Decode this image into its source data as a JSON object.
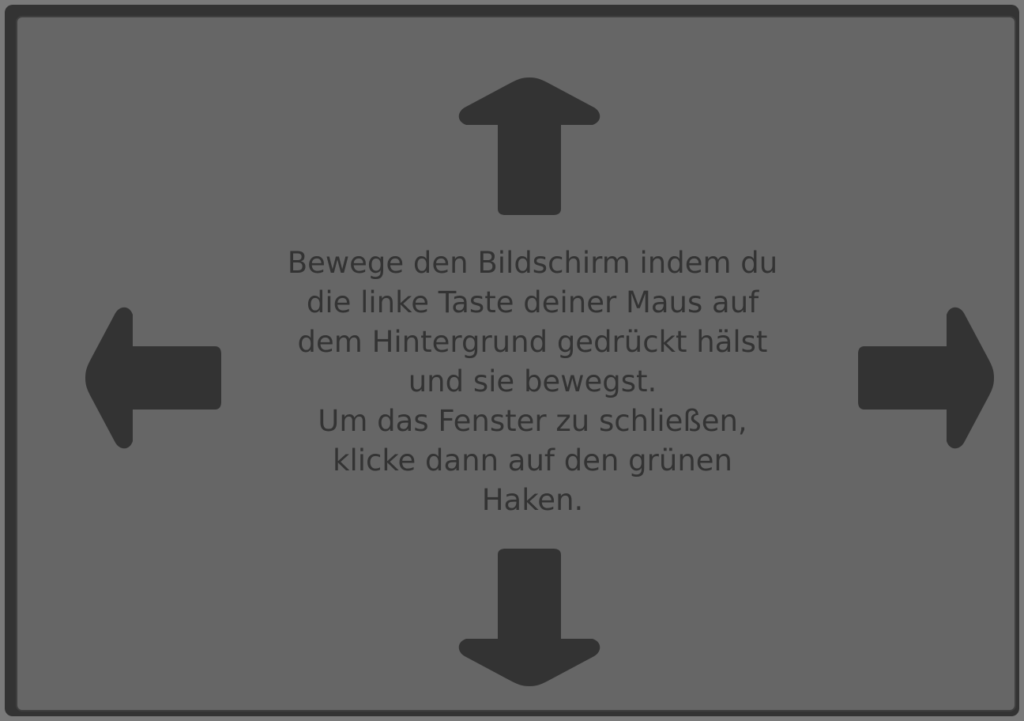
{
  "colors": {
    "outer_background": "#7a7a7a",
    "frame": "#333333",
    "panel": "#666666",
    "arrow": "#333333",
    "text": "#333333"
  },
  "arrows": {
    "up": "arrow-up-icon",
    "down": "arrow-down-icon",
    "left": "arrow-left-icon",
    "right": "arrow-right-icon"
  },
  "instructions": {
    "lines": [
      "Bewege den Bildschirm indem du",
      "die linke Taste deiner Maus auf",
      "dem Hintergrund gedrückt hälst",
      "und sie bewegst.",
      "Um das Fenster zu schließen,",
      "klicke dann auf den grünen",
      "Haken."
    ]
  }
}
